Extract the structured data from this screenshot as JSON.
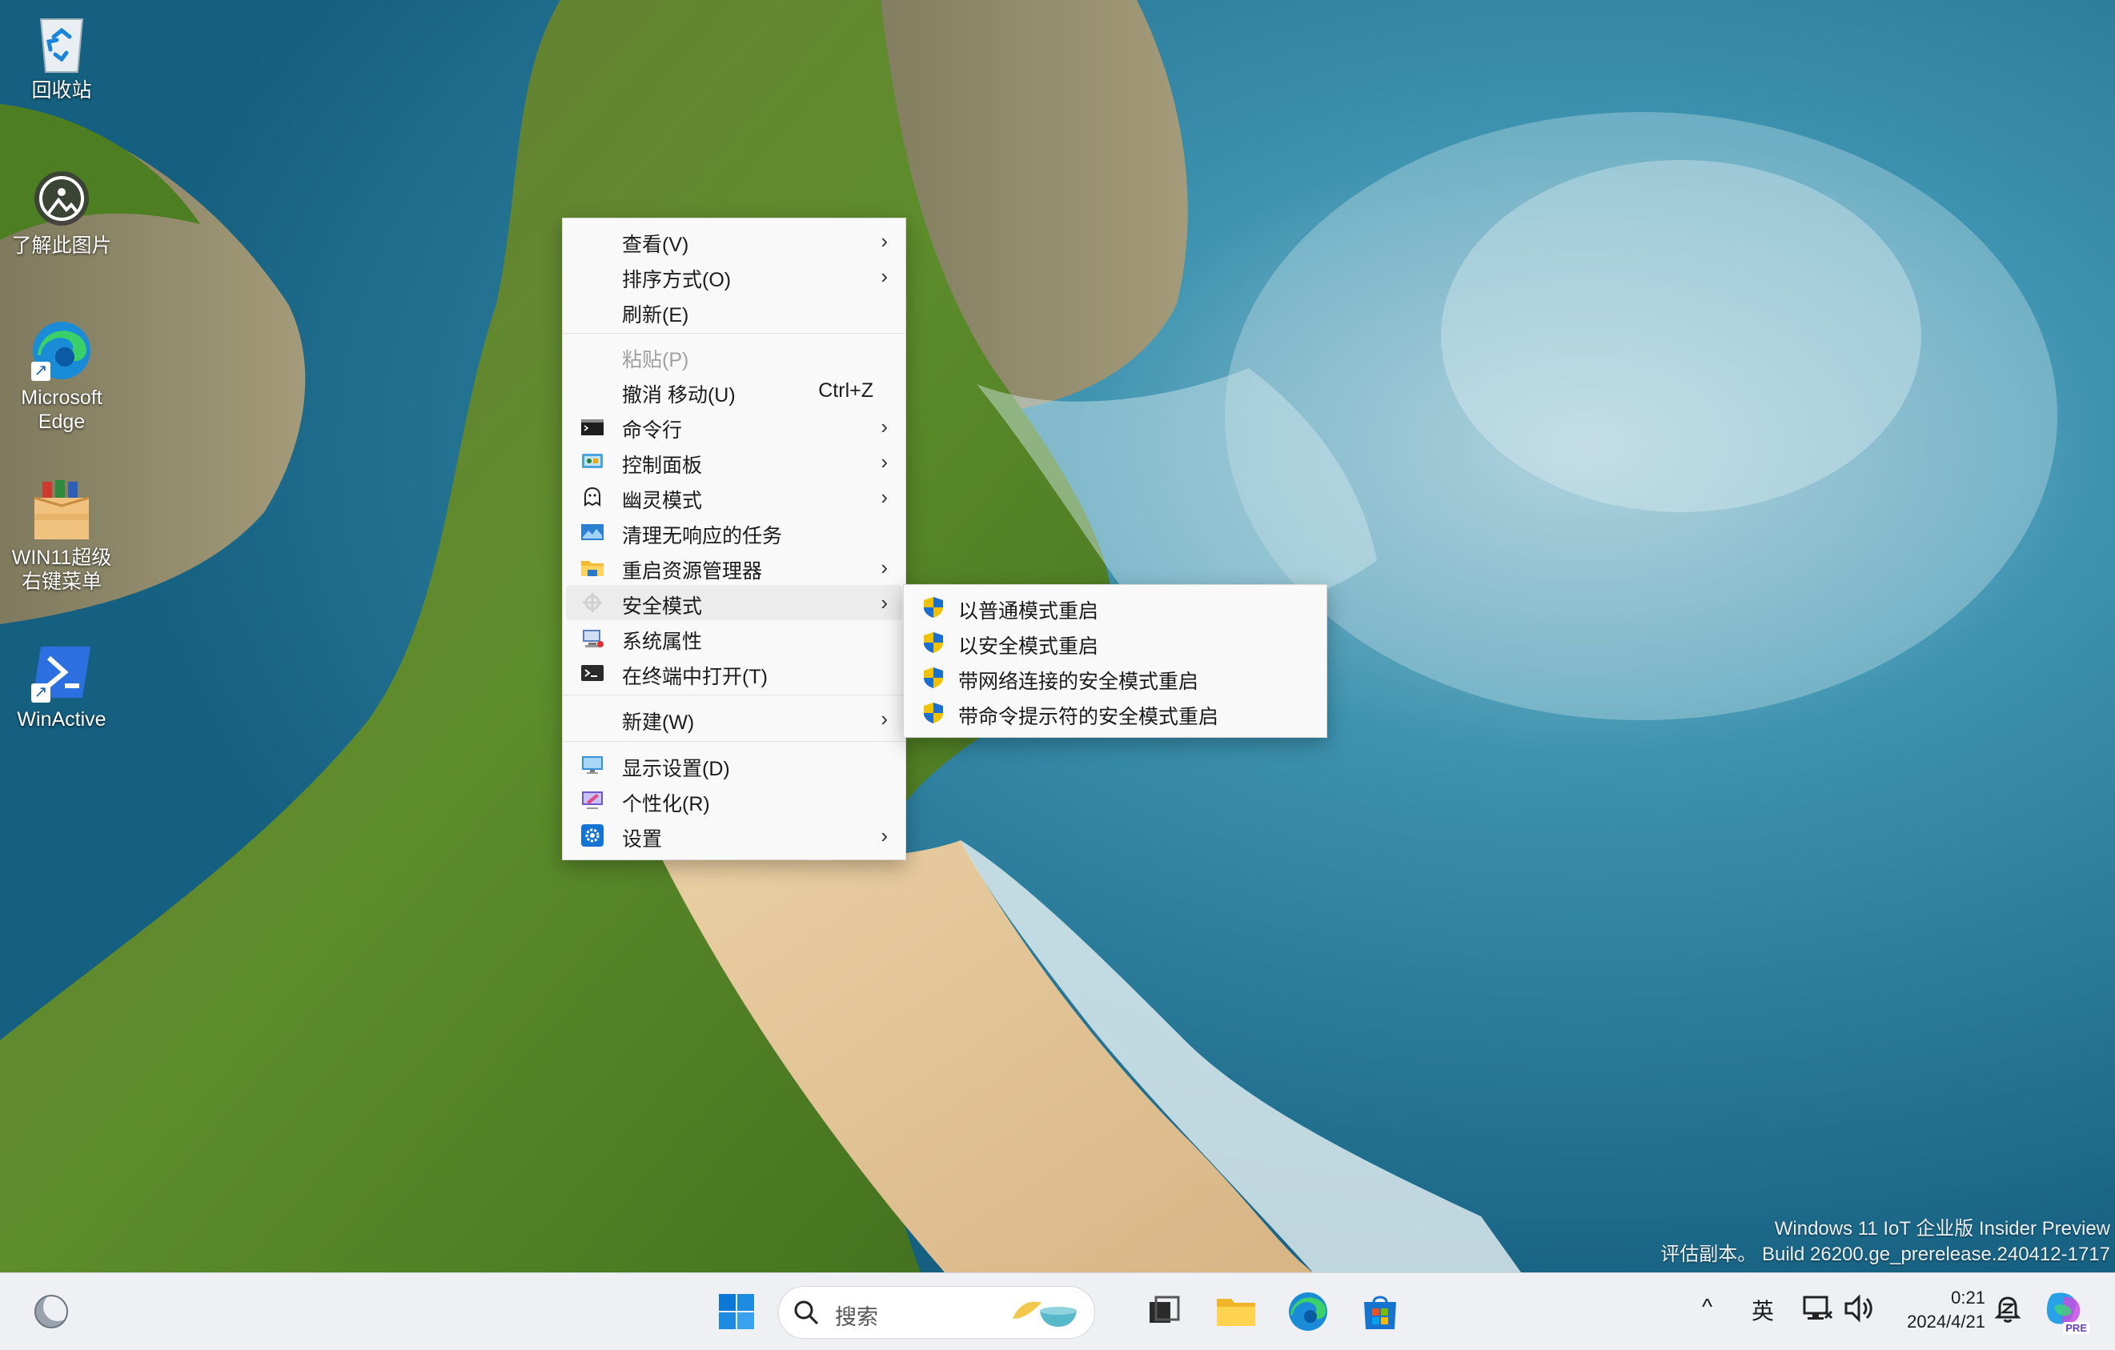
{
  "desktop_icons": [
    {
      "label": "回收站",
      "icon": "recycle-bin-icon"
    },
    {
      "label": "了解此图片",
      "icon": "learn-about-picture-icon"
    },
    {
      "label": "Microsoft\nEdge",
      "icon": "edge-icon"
    },
    {
      "label": "WIN11超级\n右键菜单",
      "icon": "package-icon"
    },
    {
      "label": "WinActive",
      "icon": "powershell-icon"
    }
  ],
  "context_menu": {
    "items": [
      {
        "label": "查看(V)",
        "submenu": true
      },
      {
        "label": "排序方式(O)",
        "submenu": true
      },
      {
        "label": "刷新(E)"
      },
      {
        "label": "粘贴(P)",
        "disabled": true
      },
      {
        "label": "撤消 移动(U)",
        "shortcut": "Ctrl+Z"
      },
      {
        "label": "命令行",
        "icon": "cmd-icon",
        "submenu": true
      },
      {
        "label": "控制面板",
        "icon": "control-panel-icon",
        "submenu": true
      },
      {
        "label": "幽灵模式",
        "icon": "ghost-icon",
        "submenu": true
      },
      {
        "label": "清理无响应的任务",
        "icon": "task-cleanup-icon"
      },
      {
        "label": "重启资源管理器",
        "icon": "folder-icon",
        "submenu": true
      },
      {
        "label": "安全模式",
        "icon": "safe-mode-icon",
        "submenu": true,
        "highlighted": true
      },
      {
        "label": "系统属性",
        "icon": "system-properties-icon"
      },
      {
        "label": "在终端中打开(T)",
        "icon": "terminal-icon"
      },
      {
        "label": "新建(W)",
        "submenu": true
      },
      {
        "label": "显示设置(D)",
        "icon": "display-settings-icon"
      },
      {
        "label": "个性化(R)",
        "icon": "personalize-icon"
      },
      {
        "label": "设置",
        "icon": "settings-gear-icon",
        "submenu": true
      }
    ]
  },
  "safe_mode_submenu": {
    "items": [
      {
        "label": "以普通模式重启",
        "icon": "uac-shield-icon"
      },
      {
        "label": "以安全模式重启",
        "icon": "uac-shield-icon"
      },
      {
        "label": "带网络连接的安全模式重启",
        "icon": "uac-shield-icon"
      },
      {
        "label": "带命令提示符的安全模式重启",
        "icon": "uac-shield-icon"
      }
    ]
  },
  "watermark": {
    "line1": "Windows 11 IoT 企业版 Insider Preview",
    "line2": "评估副本。 Build 26200.ge_prerelease.240412-1717"
  },
  "taskbar": {
    "search_placeholder": "搜索",
    "ime_label": "英",
    "time": "0:21",
    "date": "2024/4/21",
    "copilot_badge": "PRE"
  },
  "colors": {
    "menu_bg": "#f9f9f9",
    "menu_highlight": "#ececec",
    "taskbar_bg": "#eef0f3",
    "windows_blue": "#0078d4"
  }
}
